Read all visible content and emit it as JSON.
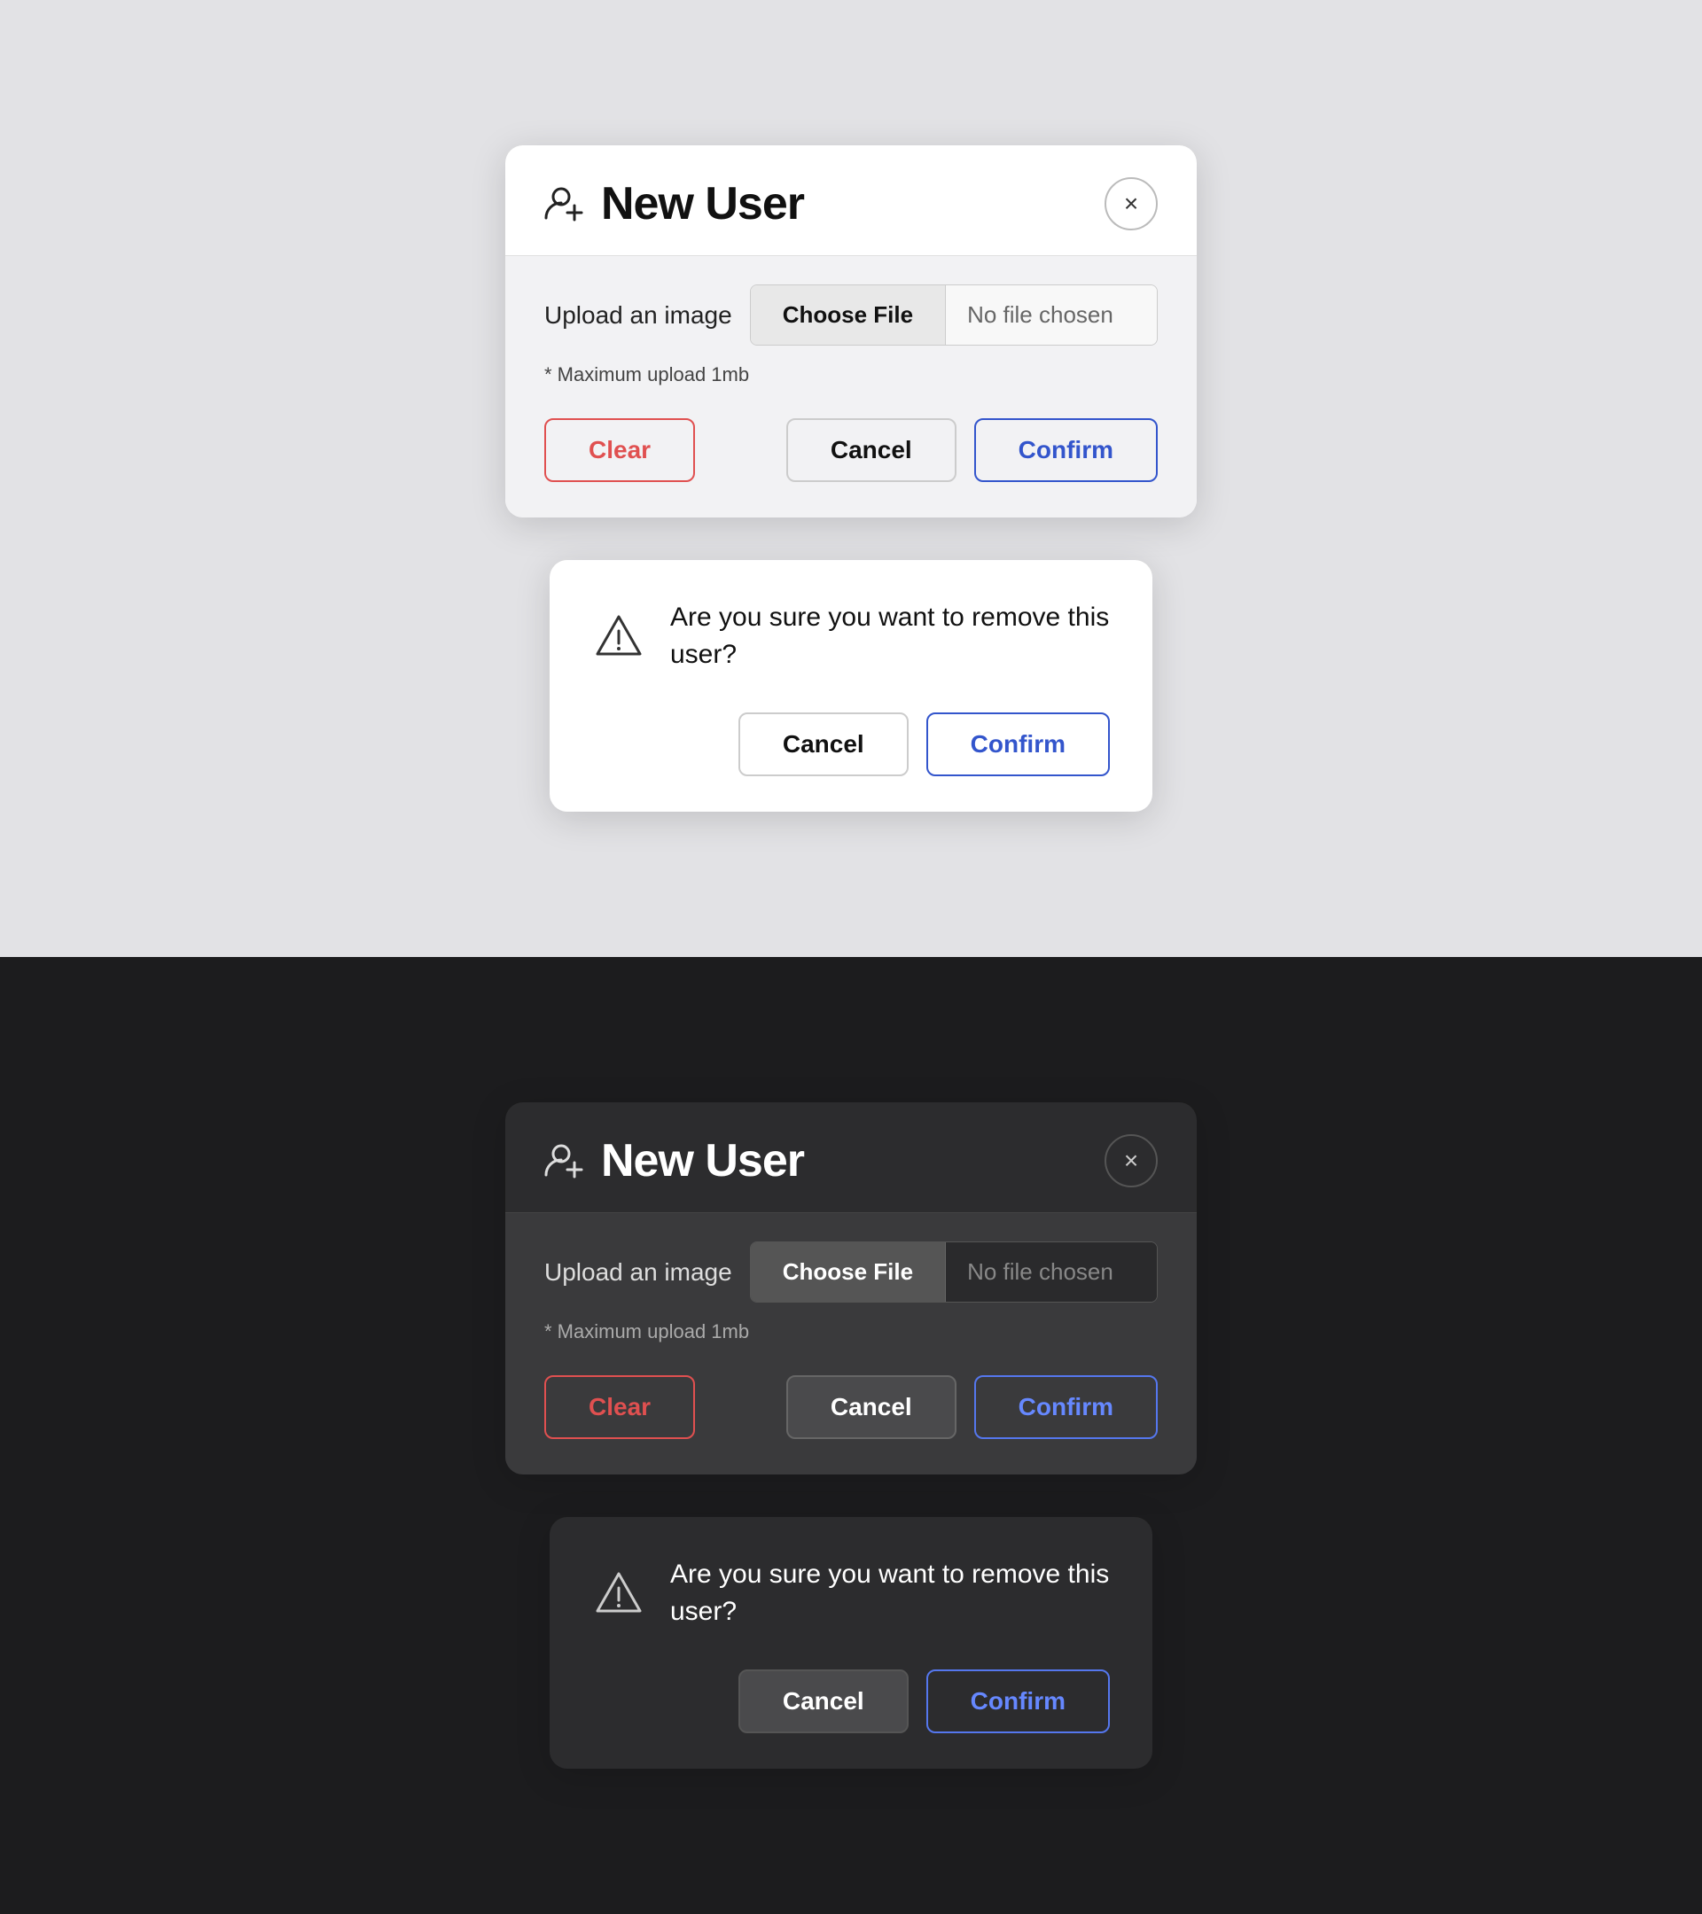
{
  "light": {
    "theme": "light",
    "modal": {
      "title": "New User",
      "close_label": "×",
      "upload_label": "Upload an image",
      "choose_file_label": "Choose File",
      "no_file_label": "No file chosen",
      "max_upload_note": "* Maximum upload 1mb",
      "clear_label": "Clear",
      "cancel_label": "Cancel",
      "confirm_label": "Confirm"
    },
    "confirm_dialog": {
      "message": "Are you sure you want to remove this user?",
      "cancel_label": "Cancel",
      "confirm_label": "Confirm"
    }
  },
  "dark": {
    "theme": "dark",
    "modal": {
      "title": "New User",
      "close_label": "×",
      "upload_label": "Upload an image",
      "choose_file_label": "Choose File",
      "no_file_label": "No file chosen",
      "max_upload_note": "* Maximum upload 1mb",
      "clear_label": "Clear",
      "cancel_label": "Cancel",
      "confirm_label": "Confirm"
    },
    "confirm_dialog": {
      "message": "Are you sure you want to remove this user?",
      "cancel_label": "Cancel",
      "confirm_label": "Confirm"
    }
  },
  "icons": {
    "user_plus": "user-plus-icon",
    "warning": "warning-icon",
    "close": "close-icon"
  }
}
